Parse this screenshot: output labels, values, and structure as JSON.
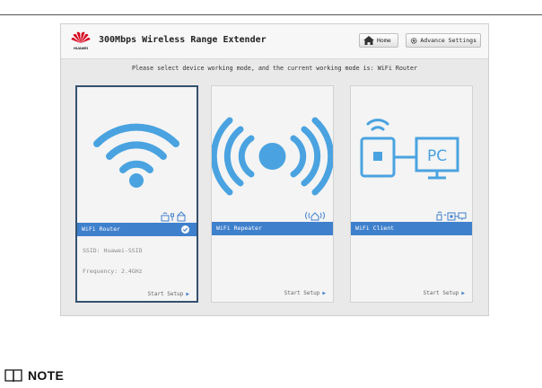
{
  "app": {
    "logo_text": "HUAWEI",
    "title": "300Mbps Wireless Range Extender",
    "home_button": "Home",
    "advanced_button": "Advance Settings"
  },
  "hint": "Please select device working mode, and the current working mode is: WiFi Router",
  "modes": [
    {
      "label": "WiFi Router",
      "selected": true,
      "ssid": "SSID: Huawei-SSID",
      "frequency": "Frequency: 2.4GHz",
      "setup": "Start Setup"
    },
    {
      "label": "WiFi Repeater",
      "selected": false,
      "setup": "Start Setup"
    },
    {
      "label": "WiFi Client",
      "selected": false,
      "pc_label": "PC",
      "setup": "Start Setup"
    }
  ],
  "note": "NOTE",
  "colors": {
    "accent": "#3f80cc",
    "wifi_blue": "#4aa3e0",
    "selected_border": "#35506e"
  }
}
